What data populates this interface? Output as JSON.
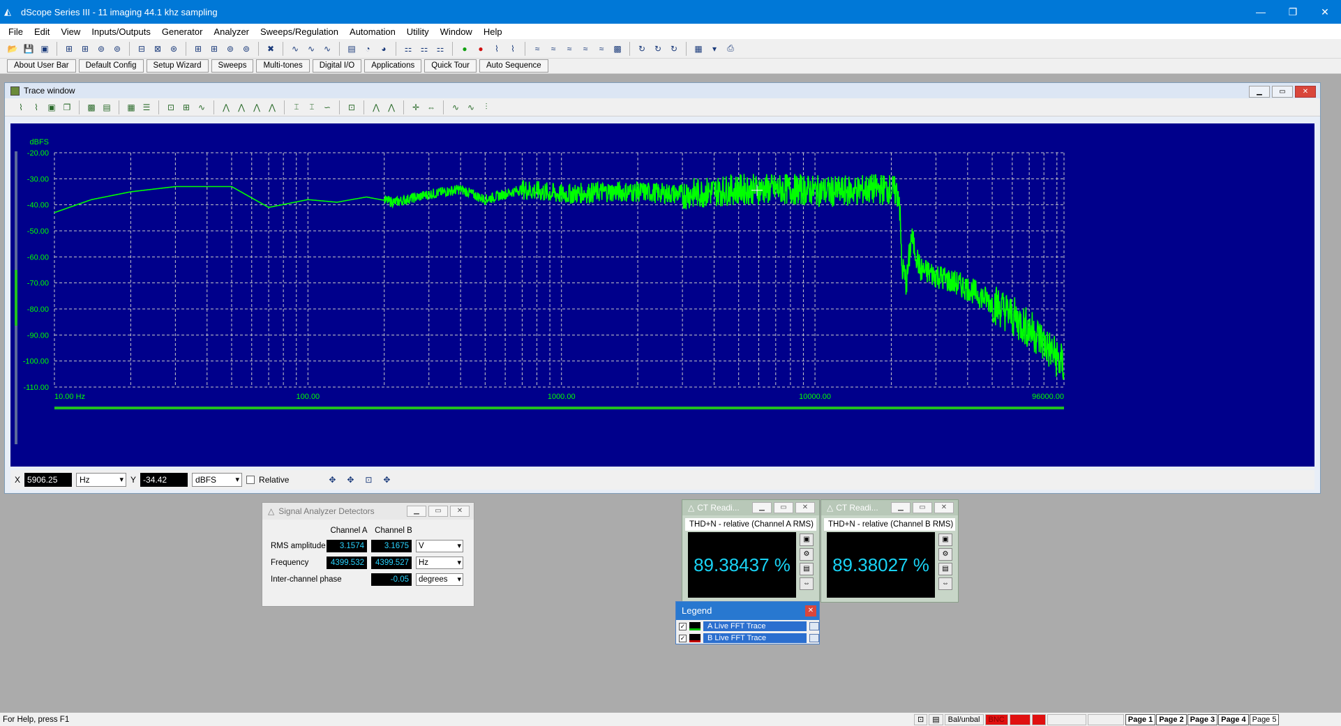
{
  "window": {
    "title": "dScope Series III - 11  imaging 44.1 khz sampling",
    "controls": [
      "—",
      "❐",
      "✕"
    ]
  },
  "menu": [
    "File",
    "Edit",
    "View",
    "Inputs/Outputs",
    "Generator",
    "Analyzer",
    "Sweeps/Regulation",
    "Automation",
    "Utility",
    "Window",
    "Help"
  ],
  "userbar": [
    "About User Bar",
    "Default Config",
    "Setup Wizard",
    "Sweeps",
    "Multi-tones",
    "Digital I/O",
    "Applications",
    "Quick Tour",
    "Auto Sequence"
  ],
  "trace_window": {
    "title": "Trace window",
    "cursor": {
      "x_label": "X",
      "x_value": "5906.25",
      "x_unit": "Hz",
      "y_label": "Y",
      "y_value": "-34.42",
      "y_unit": "dBFS",
      "relative_label": "Relative"
    }
  },
  "chart_data": {
    "type": "line",
    "ylabel": "dBFS",
    "y_ticks": [
      "-20.00",
      "-30.00",
      "-40.00",
      "-50.00",
      "-60.00",
      "-70.00",
      "-80.00",
      "-90.00",
      "-100.00",
      "-110.00"
    ],
    "ylim": [
      -110,
      -20
    ],
    "x_scale": "log",
    "x_ticks": [
      "10.00 Hz",
      "100.00",
      "1000.00",
      "10000.00",
      "96000.00"
    ],
    "xlim": [
      10,
      96000
    ],
    "grid": true,
    "series": [
      {
        "color": "#00ff00",
        "x": [
          10,
          14,
          20,
          30,
          50,
          70,
          100,
          130,
          170,
          220,
          300,
          400,
          500,
          700,
          1000,
          1500,
          2000,
          3000,
          5000,
          8000,
          12000,
          17000,
          20000,
          21500,
          22000,
          23000,
          24000,
          26000,
          30000,
          40000,
          55000,
          75000,
          96000
        ],
        "y": [
          -43,
          -38,
          -35,
          -33,
          -33,
          -41,
          -38,
          -39,
          -37,
          -39,
          -36,
          -34,
          -38,
          -34,
          -36,
          -35,
          -35,
          -36,
          -34,
          -34,
          -35,
          -34,
          -34,
          -36,
          -64,
          -70,
          -52,
          -65,
          -67,
          -72,
          -80,
          -90,
          -102
        ]
      }
    ]
  },
  "detectors": {
    "title": "Signal Analyzer Detectors",
    "col_a": "Channel A",
    "col_b": "Channel B",
    "rows": [
      {
        "label": "RMS amplitude",
        "a": "3.1574",
        "b": "3.1675",
        "unit": "V"
      },
      {
        "label": "Frequency",
        "a": "4399.532",
        "b": "4399.527",
        "unit": "Hz"
      },
      {
        "label": "Inter-channel phase",
        "a": "",
        "b": "-0.05",
        "unit": "degrees"
      }
    ]
  },
  "ct_a": {
    "title": "CT Readi...",
    "label": "THD+N - relative (Channel A RMS)",
    "value": "89.38437 %"
  },
  "ct_b": {
    "title": "CT Readi...",
    "label": "THD+N - relative (Channel B RMS)",
    "value": "89.38027 %"
  },
  "legend": {
    "title": "Legend",
    "items": [
      {
        "label": "A  Live FFT Trace",
        "color": "#00c000"
      },
      {
        "label": "B  Live FFT Trace",
        "color": "#c00000"
      }
    ]
  },
  "status": {
    "help": "For Help, press F1",
    "items": [
      "Bal/unbal",
      "BNC",
      "Page 1",
      "Page 2",
      "Page 3",
      "Page 4",
      "Page 5"
    ]
  }
}
